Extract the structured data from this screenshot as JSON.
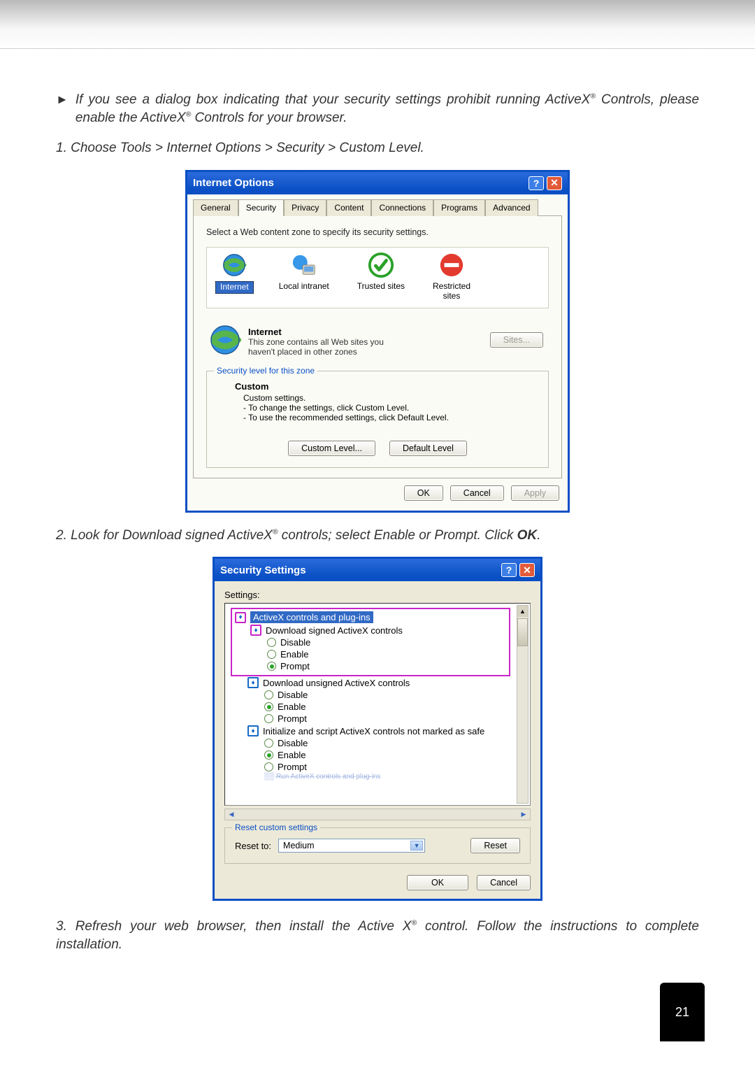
{
  "page_number": "21",
  "paragraphs": {
    "p1a": "If you see a dialog box indicating that your security settings prohibit running ActiveX",
    "p1b": "Controls, please enable the ActiveX",
    "p1c": " Controls for your browser.",
    "step1": "1. Choose Tools > Internet Options > Security > Custom Level.",
    "step2a": "2. Look for Download signed ActiveX",
    "step2b": " controls; select Enable or Prompt. Click ",
    "step2c": "OK",
    "step2d": ".",
    "step3a": "3. Refresh your web browser, then install the Active X",
    "step3b": " control. Follow the instructions to complete installation."
  },
  "io": {
    "title": "Internet Options",
    "tabs": [
      "General",
      "Security",
      "Privacy",
      "Content",
      "Connections",
      "Programs",
      "Advanced"
    ],
    "zone_instruction": "Select a Web content zone to specify its security settings.",
    "zones": {
      "internet": "Internet",
      "local": "Local intranet",
      "trusted": "Trusted sites",
      "restricted": "Restricted\nsites"
    },
    "zone_detail": {
      "name": "Internet",
      "desc1": "This zone contains all Web sites you",
      "desc2": "haven't placed in other zones",
      "sites_btn": "Sites..."
    },
    "sec_level_legend": "Security level for this zone",
    "custom": {
      "head": "Custom",
      "line0": "Custom settings.",
      "line1": "- To change the settings, click Custom Level.",
      "line2": "- To use the recommended settings, click Default Level."
    },
    "buttons": {
      "custom_level": "Custom Level...",
      "default_level": "Default Level",
      "ok": "OK",
      "cancel": "Cancel",
      "apply": "Apply"
    }
  },
  "ss": {
    "title": "Security Settings",
    "settings_label": "Settings:",
    "tree": {
      "root": "ActiveX controls and plug-ins",
      "g1": "Download signed ActiveX controls",
      "g2": "Download unsigned ActiveX controls",
      "g3": "Initialize and script ActiveX controls not marked as safe",
      "disable": "Disable",
      "enable": "Enable",
      "prompt": "Prompt",
      "cut": "Run ActiveX controls and plug-ins"
    },
    "reset": {
      "legend": "Reset custom settings",
      "label": "Reset to:",
      "value": "Medium",
      "btn": "Reset"
    },
    "buttons": {
      "ok": "OK",
      "cancel": "Cancel"
    }
  }
}
